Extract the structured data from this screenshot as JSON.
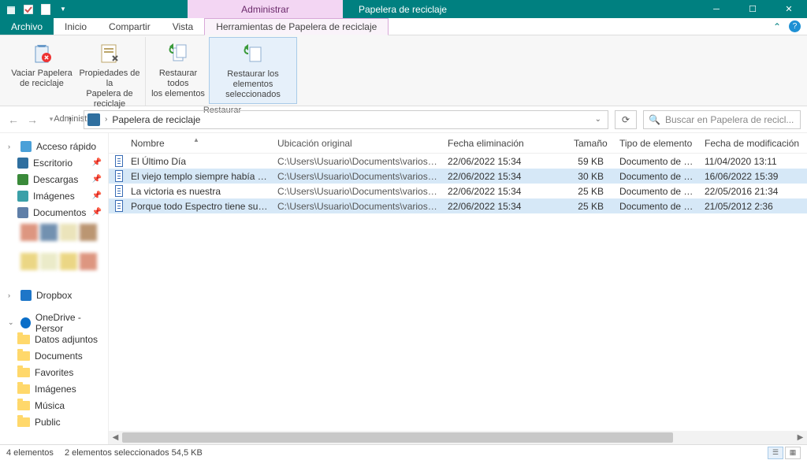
{
  "titlebar": {
    "context_tab": "Administrar",
    "title": "Papelera de reciclaje"
  },
  "tabs": {
    "file": "Archivo",
    "home": "Inicio",
    "share": "Compartir",
    "view": "Vista",
    "tools": "Herramientas de Papelera de reciclaje"
  },
  "ribbon": {
    "empty": "Vaciar Papelera\nde reciclaje",
    "props": "Propiedades de la\nPapelera de reciclaje",
    "group_admin": "Administrar",
    "restore_all": "Restaurar todos\nlos elementos",
    "restore_sel": "Restaurar los elementos\nseleccionados",
    "group_restore": "Restaurar"
  },
  "breadcrumb": {
    "location": "Papelera de reciclaje"
  },
  "search": {
    "placeholder": "Buscar en Papelera de recicl..."
  },
  "columns": {
    "name": "Nombre",
    "orig": "Ubicación original",
    "deleted": "Fecha eliminación",
    "size": "Tamaño",
    "type": "Tipo de elemento",
    "modified": "Fecha de modificación"
  },
  "rows": [
    {
      "name": "El Último Día",
      "loc": "C:\\Users\\Usuario\\Documents\\varios_escr...",
      "del": "22/06/2022 15:34",
      "size": "59 KB",
      "type": "Documento de Mi...",
      "mod": "11/04/2020 13:11",
      "selected": false
    },
    {
      "name": "El viejo templo siempre había esta...",
      "loc": "C:\\Users\\Usuario\\Documents\\varios_escr...",
      "del": "22/06/2022 15:34",
      "size": "30 KB",
      "type": "Documento de Mi...",
      "mod": "16/06/2022 15:39",
      "selected": true
    },
    {
      "name": "La victoria es nuestra",
      "loc": "C:\\Users\\Usuario\\Documents\\varios_escr...",
      "del": "22/06/2022 15:34",
      "size": "25 KB",
      "type": "Documento de Mi...",
      "mod": "22/05/2016 21:34",
      "selected": false
    },
    {
      "name": "Porque todo Espectro tiene su cora...",
      "loc": "C:\\Users\\Usuario\\Documents\\varios_escr...",
      "del": "22/06/2022 15:34",
      "size": "25 KB",
      "type": "Documento de Mi...",
      "mod": "21/05/2012 2:36",
      "selected": true
    }
  ],
  "sidebar": {
    "quick": "Acceso rápido",
    "desktop": "Escritorio",
    "downloads": "Descargas",
    "pictures": "Imágenes",
    "documents": "Documentos",
    "dropbox": "Dropbox",
    "onedrive": "OneDrive - Persor",
    "attachments": "Datos adjuntos",
    "docs2": "Documents",
    "favorites": "Favorites",
    "images2": "Imágenes",
    "music": "Música",
    "public": "Public"
  },
  "status": {
    "count": "4 elementos",
    "selection": "2 elementos seleccionados  54,5 KB"
  },
  "colors": {
    "accent": "#008080",
    "selection": "#d6e8f7"
  }
}
